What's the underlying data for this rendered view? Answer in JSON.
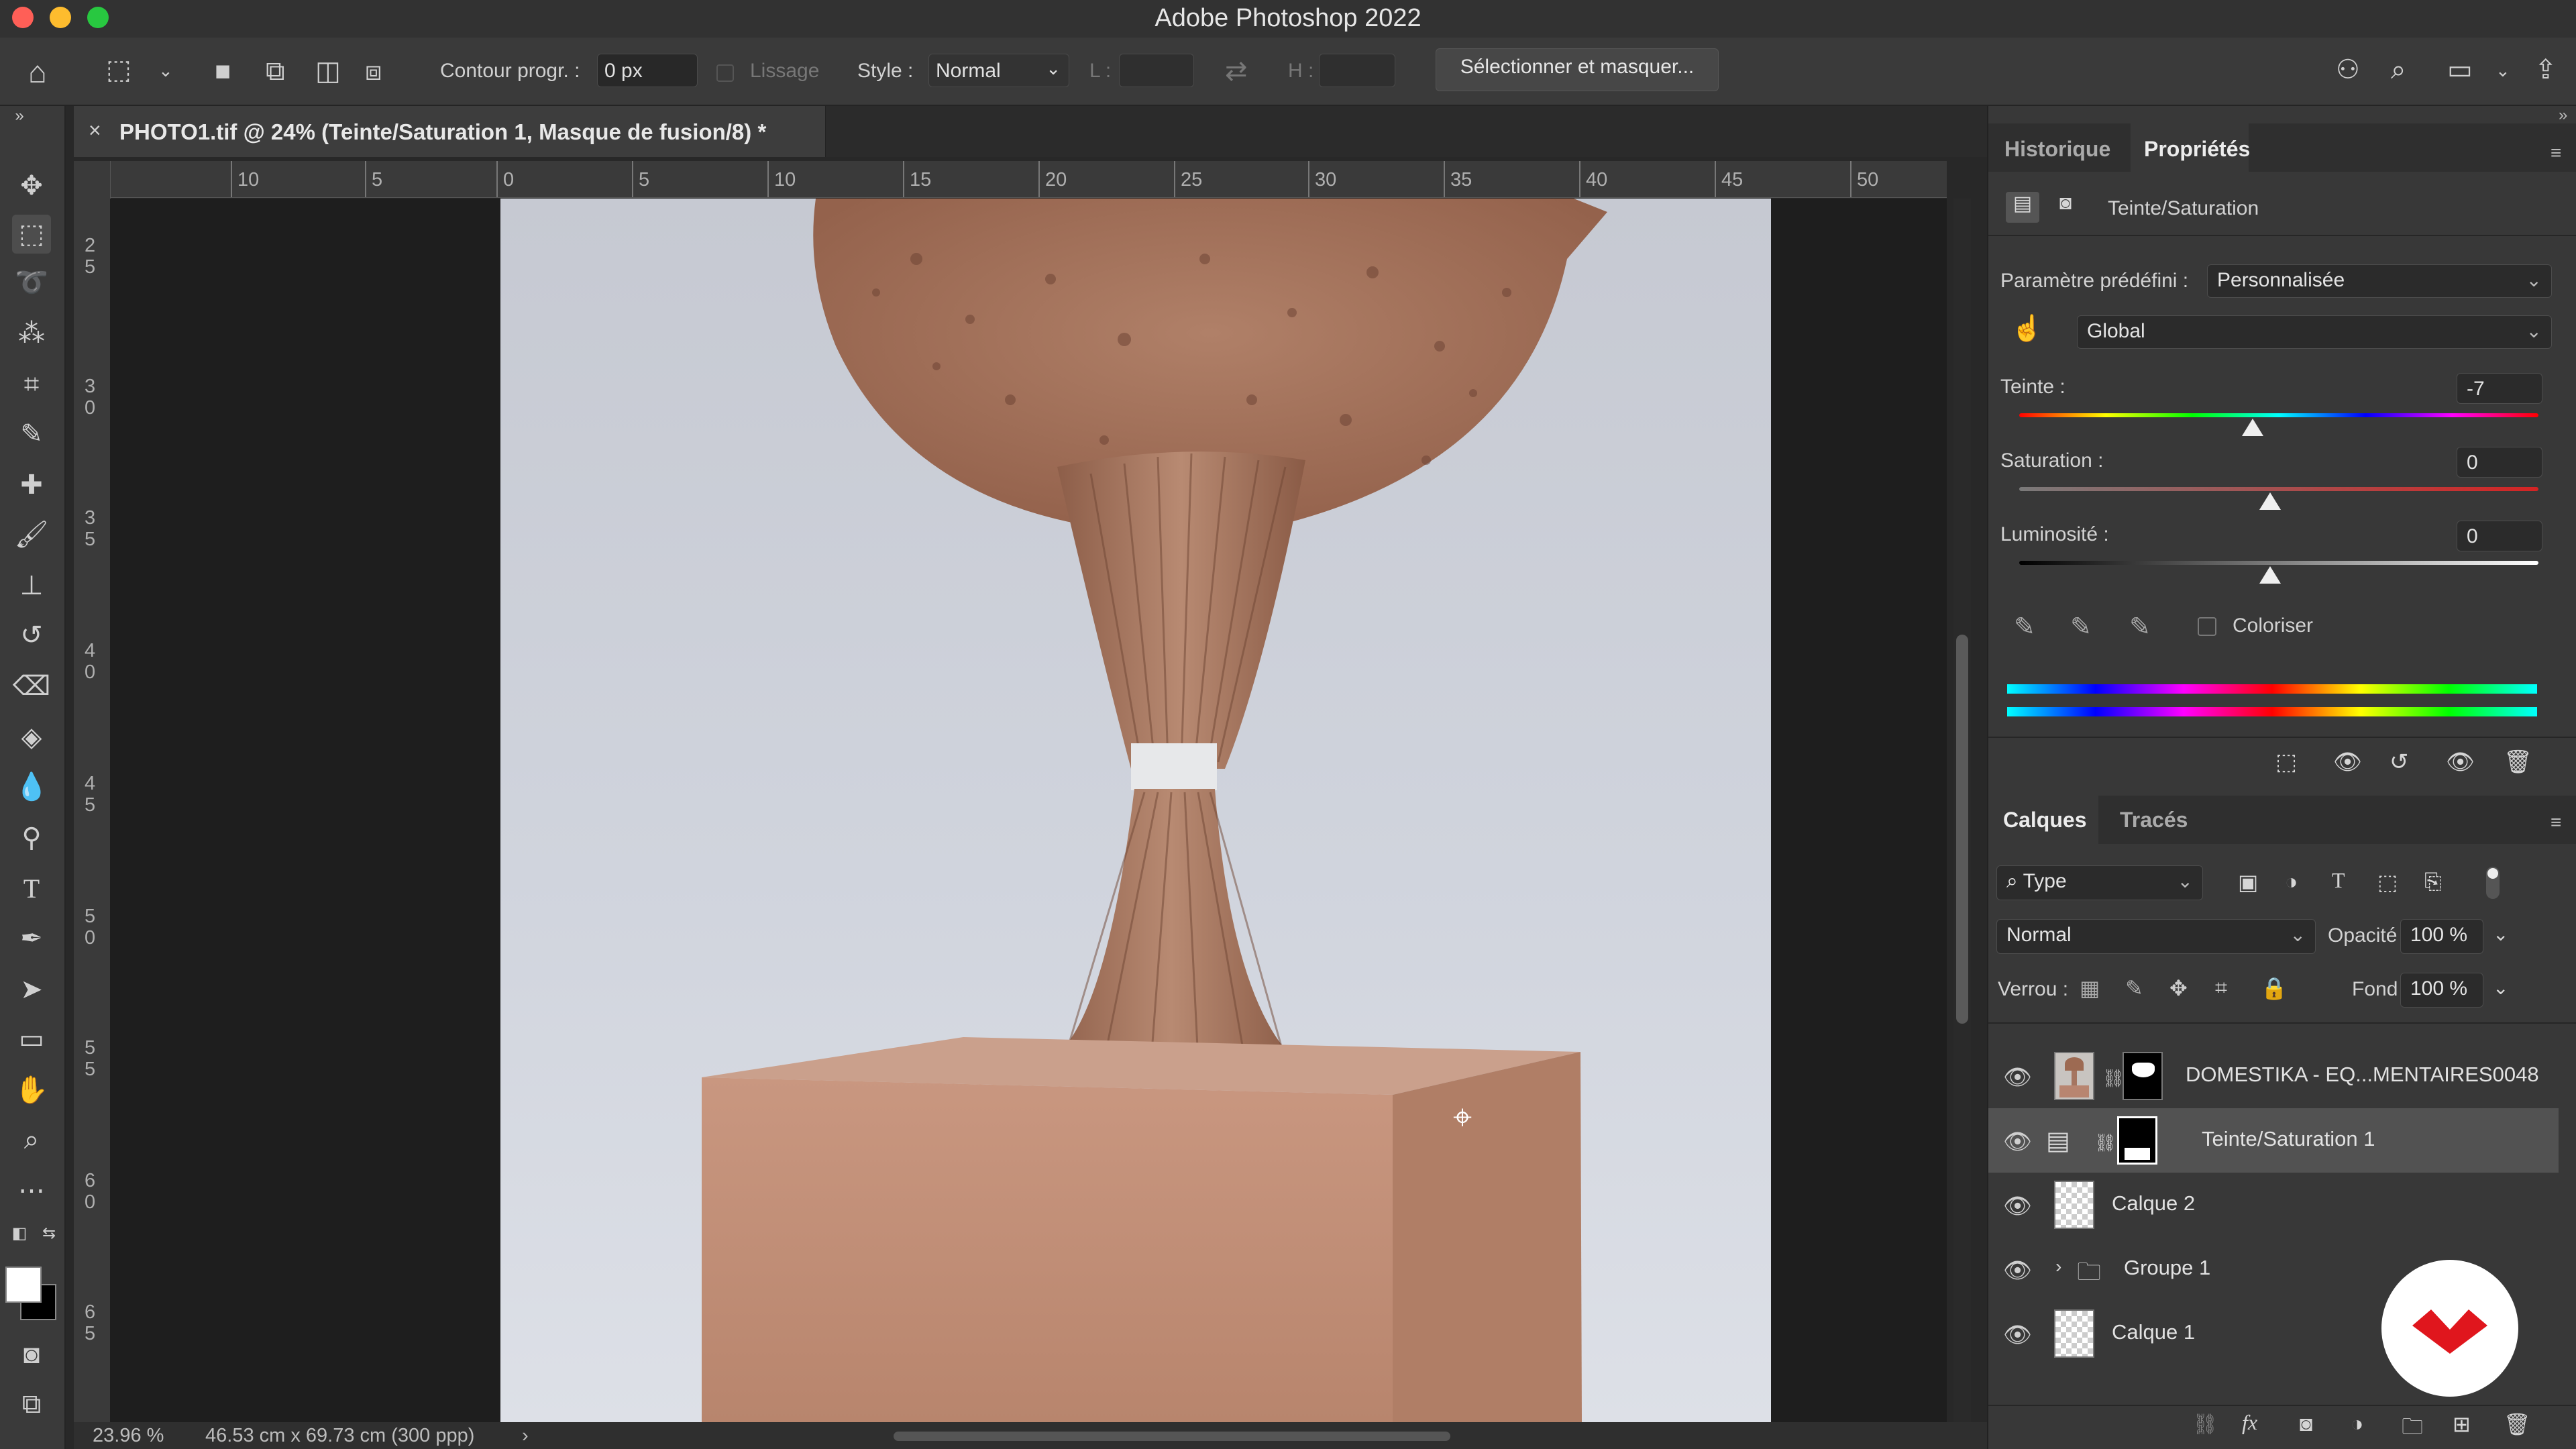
{
  "window": {
    "title": "Adobe Photoshop 2022"
  },
  "options_bar": {
    "feather_label": "Contour progr. :",
    "feather_value": "0 px",
    "antialias_label": "Lissage",
    "style_label": "Style :",
    "style_value": "Normal",
    "width_label": "L :",
    "height_label": "H :",
    "select_mask_button": "Sélectionner et masquer..."
  },
  "document": {
    "tab_title": "PHOTO1.tif @ 24% (Teinte/Saturation 1, Masque de fusion/8) *",
    "ruler_h": [
      "10",
      "5",
      "0",
      "5",
      "10",
      "15",
      "20",
      "25",
      "30",
      "35",
      "40",
      "45",
      "50"
    ],
    "ruler_v": [
      [
        "2",
        "5"
      ],
      [
        "3",
        "0"
      ],
      [
        "3",
        "5"
      ],
      [
        "4",
        "0"
      ],
      [
        "4",
        "5"
      ],
      [
        "5",
        "0"
      ],
      [
        "5",
        "5"
      ],
      [
        "6",
        "0"
      ],
      [
        "6",
        "5"
      ]
    ],
    "zoom": "23.96 %",
    "doc_size": "46.53 cm x 69.73 cm (300 ppp)"
  },
  "properties_panel": {
    "tabs": [
      "Historique",
      "Propriétés"
    ],
    "active_tab": "Propriétés",
    "adjustment_title": "Teinte/Saturation",
    "preset_label": "Paramètre prédéfini :",
    "preset_value": "Personnalisée",
    "channel_value": "Global",
    "hue_label": "Teinte :",
    "hue_value": "-7",
    "saturation_label": "Saturation :",
    "saturation_value": "0",
    "lightness_label": "Luminosité :",
    "lightness_value": "0",
    "colorize_label": "Coloriser",
    "colorize_checked": false
  },
  "layers_panel": {
    "tabs": [
      "Calques",
      "Tracés"
    ],
    "active_tab": "Calques",
    "filter_value": "Type",
    "blend_mode": "Normal",
    "opacity_label": "Opacité :",
    "opacity_value": "100 %",
    "lock_label": "Verrou :",
    "fill_label": "Fond :",
    "fill_value": "100 %",
    "layers": [
      {
        "name": "DOMESTIKA - EQ...MENTAIRES0048",
        "visible": true,
        "type": "pixel-with-mask"
      },
      {
        "name": "Teinte/Saturation 1",
        "visible": true,
        "type": "adjustment",
        "selected": true
      },
      {
        "name": "Calque 2",
        "visible": true,
        "type": "pixel"
      },
      {
        "name": "Groupe 1",
        "visible": true,
        "type": "group"
      },
      {
        "name": "Calque 1",
        "visible": true,
        "type": "pixel"
      }
    ]
  },
  "colors": {
    "titlebar": "#323232",
    "panel": "#383838",
    "accent_close": "#ff5f57",
    "accent_min": "#febc2e",
    "accent_max": "#28c840",
    "badge_red": "#e0161d"
  }
}
